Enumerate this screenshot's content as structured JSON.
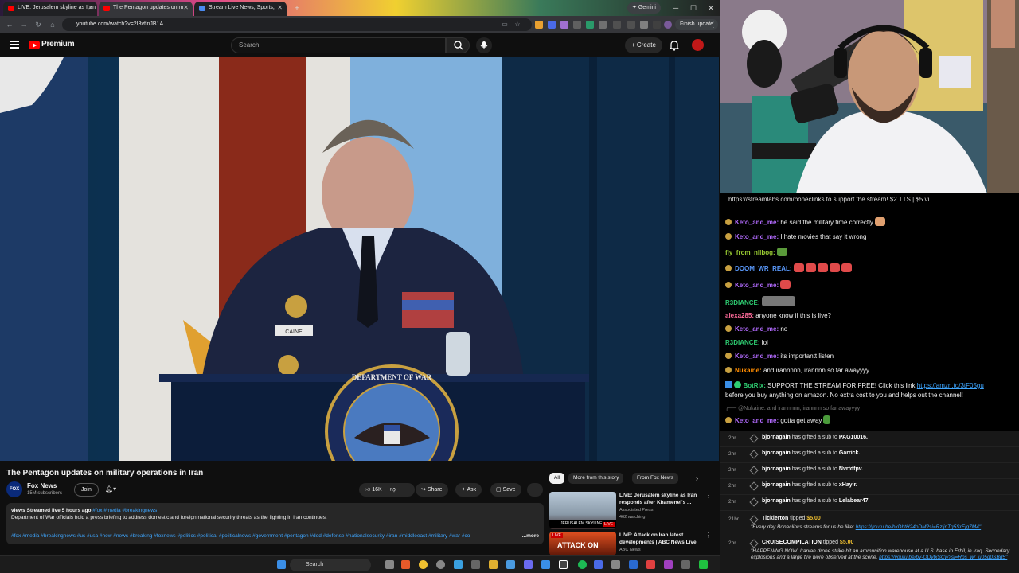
{
  "browser": {
    "tabs": [
      {
        "label": "LIVE: Jerusalem skyline as Iran"
      },
      {
        "label": "The Pentagon updates on m"
      },
      {
        "label": "Stream Live News, Sports,"
      }
    ],
    "gemini_label": "Gemini",
    "url": "youtube.com/watch?v=2I3vflnJB1A",
    "finish_update_label": "Finish update",
    "window_controls": {
      "minimize": "─",
      "maximize": "☐",
      "close": "✕"
    }
  },
  "youtube": {
    "brand": "Premium",
    "search_placeholder": "Search",
    "create_label": "+ Create",
    "video": {
      "title": "The Pentagon updates on military operations in Iran",
      "channel": "Fox News",
      "subscribers": "15M subscribers",
      "join_label": "Join",
      "likes": "16K",
      "share_label": "Share",
      "ask_label": "Ask",
      "save_label": "Save",
      "description": {
        "meta": "views  Streamed live 5 hours ago",
        "tags": "#fox #media #breakingnews",
        "body": "Department of War officials hold a press briefing to address domestic and foreign national security threats as the fighting in Iran continues.",
        "hashtags": "#fox #media #breakingnews #us #usa #new #news #breaking #foxnews #politics #political #politicalnews #government #pentagon #dod #defense #nationalsecurity #iran #middleeast #military #war #co",
        "more_label": "...more"
      },
      "lower_text": {
        "badge": "CAINE",
        "seal": "DEPARTMENT OF WAR"
      }
    },
    "chips": [
      {
        "label": "All",
        "selected": true
      },
      {
        "label": "More from this story",
        "selected": false
      },
      {
        "label": "From Fox News",
        "selected": false
      }
    ],
    "recommended": [
      {
        "title": "LIVE: Jerusalem skyline as Iran responds after Khamenei's ...",
        "channel": "Associated Press",
        "stats": "462 watching",
        "thumb_caption": "JERUSALEM SKYLINE",
        "live_label": "LIVE"
      },
      {
        "title": "LIVE: Attack on Iran latest developments | ABC News Live",
        "channel": "ABC News",
        "stats": "",
        "thumb_caption": "ATTACK ON",
        "live_label": "LIVE"
      }
    ]
  },
  "taskbar": {
    "search_label": "Search"
  },
  "chat": {
    "banner": "https://streamlabs.com/boneclinks to support the stream! $2 TTS | $5 vi...",
    "messages": [
      {
        "user": "Keto_and_me:",
        "text": "he said the military time correctly",
        "color": "#b36bff"
      },
      {
        "user": "Keto_and_me:",
        "text": "I hate movies that say it wrong",
        "color": "#b36bff"
      },
      {
        "user": "fly_from_nilbog:",
        "text": "",
        "color": "#9acd32"
      },
      {
        "user": "DOOM_WR_REAL:",
        "text": "",
        "color": "#5b9bff"
      },
      {
        "user": "Keto_and_me:",
        "text": "",
        "color": "#b36bff"
      },
      {
        "user": "R3DIANCE:",
        "text": "",
        "color": "#2ecc71"
      },
      {
        "user": "alexa285:",
        "text": "anyone know if this is live?",
        "color": "#ff6b9a"
      },
      {
        "user": "Keto_and_me:",
        "text": "no",
        "color": "#b36bff"
      },
      {
        "user": "R3DIANCE:",
        "text": "lol",
        "color": "#2ecc71"
      },
      {
        "user": "Keto_and_me:",
        "text": "its importantt listen",
        "color": "#b36bff"
      },
      {
        "user": "Nukaine:",
        "text": "and irannnnn, irannnn so far awayyyy",
        "color": "#ff8c00"
      }
    ],
    "botrix": {
      "user": "BotRix:",
      "text": "SUPPORT THE STREAM FOR FREE! Click this link",
      "link": "https://amzn.to/3tF05gu",
      "text2": "before you buy anything on amazon. No extra cost to you and helps out the channel!"
    },
    "reply": "@Nukaine: and irannnnn, irannnn so far awayyyy",
    "last": {
      "user": "Keto_and_me:",
      "text": "gotta get away"
    }
  },
  "events": [
    {
      "time": "2hr",
      "user": "bjornagain",
      "text": "has gifted a sub to",
      "target": "PAG10016."
    },
    {
      "time": "2hr",
      "user": "bjornagain",
      "text": "has gifted a sub to",
      "target": "Garrick."
    },
    {
      "time": "2hr",
      "user": "bjornagain",
      "text": "has gifted a sub to",
      "target": "Nvrtdfpv."
    },
    {
      "time": "2hr",
      "user": "bjornagain",
      "text": "has gifted a sub to",
      "target": "xHayir."
    },
    {
      "time": "2hr",
      "user": "bjornagain",
      "text": "has gifted a sub to",
      "target": "Lelabear47."
    }
  ],
  "tips": [
    {
      "time": "21hr",
      "user": "Ticklerton",
      "amount": "$5.00",
      "message": "\"Every day Boneclinks streams for us be like:",
      "link": "https://youtu.be/bkDhtH24oDM?si=RzijnTg5SrEjg7M4\""
    },
    {
      "time": "2hr",
      "user": "CRUISECOMPILATION",
      "amount": "$5.00",
      "message": "\"HAPPENING NOW: Iranian drone strike hit an ammunition warehouse at a U.S. base in Erbil, in Iraq. Secondary explosions and a large fire were observed at the scene.",
      "link": "https://youtu.be/by-ODytxSCw?si=Rps_wr_u05g0SBd5\""
    }
  ],
  "tipped_label": "tipped"
}
